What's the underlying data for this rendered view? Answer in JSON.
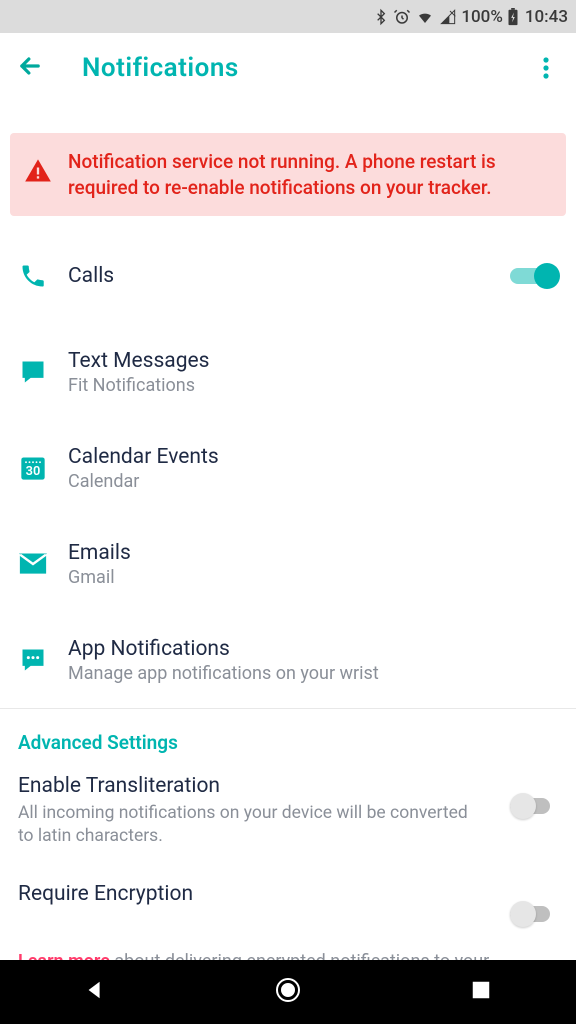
{
  "status": {
    "battery": "100%",
    "time": "10:43"
  },
  "header": {
    "title": "Notifications"
  },
  "alert": {
    "text": "Notification service not running. A phone restart is required to re-enable notifications on your tracker."
  },
  "items": [
    {
      "icon": "phone-icon",
      "label": "Calls",
      "sub": "",
      "switch": "on"
    },
    {
      "icon": "chat-icon",
      "label": "Text Messages",
      "sub": "Fit Notifications",
      "switch": ""
    },
    {
      "icon": "calendar-icon",
      "label": "Calendar Events",
      "sub": "Calendar",
      "switch": ""
    },
    {
      "icon": "mail-icon",
      "label": "Emails",
      "sub": "Gmail",
      "switch": ""
    },
    {
      "icon": "apps-icon",
      "label": "App Notifications",
      "sub": "Manage app notifications on your wrist",
      "switch": ""
    }
  ],
  "advanced": {
    "section_title": "Advanced Settings",
    "translit_label": "Enable Transliteration",
    "translit_sub": "All incoming notifications on your device will be converted to latin characters.",
    "encrypt_label": "Require Encryption",
    "learn_lead": "Learn more",
    "learn_rest": " about delivering encrypted notifications to your"
  }
}
